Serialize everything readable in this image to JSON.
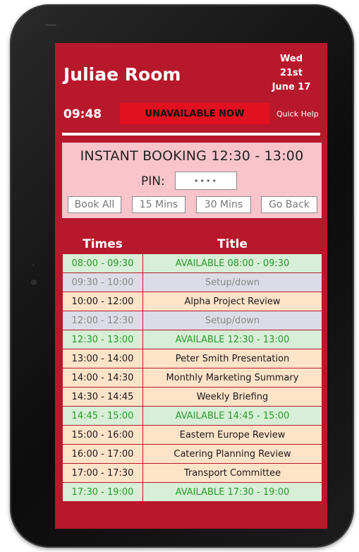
{
  "room": {
    "name": "Juliae Room",
    "date_day": "Wed",
    "date_num": "21st",
    "date_month_year": "June 17",
    "time": "09:48",
    "status": "UNAVAILABLE NOW",
    "help_label": "Quick Help"
  },
  "booking": {
    "heading": "INSTANT BOOKING 12:30 - 13:00",
    "pin_label": "PIN:",
    "pin_value": "••••",
    "buttons": {
      "book_all": "Book All",
      "mins_15": "15 Mins",
      "mins_30": "30 Mins",
      "go_back": "Go Back"
    }
  },
  "schedule": {
    "headers": {
      "times": "Times",
      "title": "Title"
    },
    "rows": [
      {
        "time": "08:00 - 09:30",
        "title": "AVAILABLE 08:00 - 09:30",
        "status": "available"
      },
      {
        "time": "09:30 - 10:00",
        "title": "Setup/down",
        "status": "setup"
      },
      {
        "time": "10:00 - 12:00",
        "title": "Alpha Project Review",
        "status": "booked"
      },
      {
        "time": "12:00 - 12:30",
        "title": "Setup/down",
        "status": "setup"
      },
      {
        "time": "12:30 - 13:00",
        "title": "AVAILABLE 12:30 - 13:00",
        "status": "available"
      },
      {
        "time": "13:00 - 14:00",
        "title": "Peter Smith Presentation",
        "status": "booked"
      },
      {
        "time": "14:00 - 14:30",
        "title": "Monthly Marketing Summary",
        "status": "booked"
      },
      {
        "time": "14:30 - 14:45",
        "title": "Weekly Briefing",
        "status": "booked"
      },
      {
        "time": "14:45 - 15:00",
        "title": "AVAILABLE 14:45 - 15:00",
        "status": "available"
      },
      {
        "time": "15:00 - 16:00",
        "title": "Eastern Europe Review",
        "status": "booked"
      },
      {
        "time": "16:00 - 17:00",
        "title": "Catering Planning Review",
        "status": "booked"
      },
      {
        "time": "17:00 - 17:30",
        "title": "Transport Committee",
        "status": "booked"
      },
      {
        "time": "17:30 - 19:00",
        "title": "AVAILABLE 17:30 - 19:00",
        "status": "available"
      }
    ]
  },
  "colors": {
    "screen_bg": "#b8182b",
    "status_red": "#e3101f",
    "booking_panel": "#f9c4cc",
    "available_bg": "#d6efd6",
    "available_text": "#2b9a2b",
    "setup_bg": "#dcdce6",
    "setup_text": "#888888",
    "booked_bg": "#fde3c8"
  }
}
